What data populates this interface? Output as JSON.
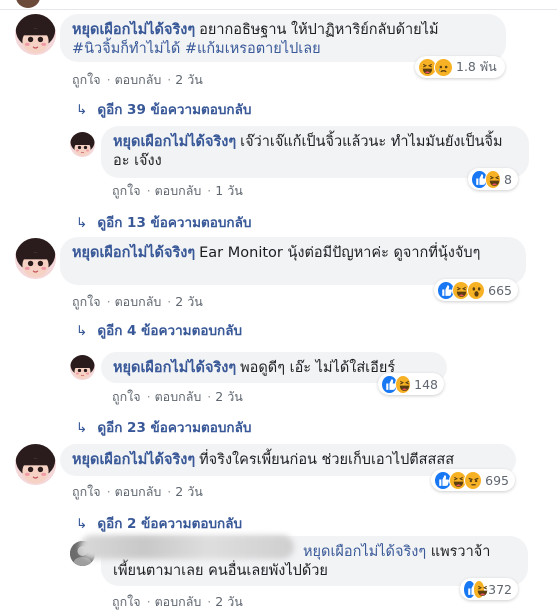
{
  "comments": [
    {
      "author": "หยุดเผือกไม่ได้จริงๆ",
      "text": "อยากอธิษฐาน ให้ปาฏิหาริย์กลับด้ายไม้",
      "tags": "#นิวจิ้มก็ทำไม่ได้ #แก้มเหรอตายไปเลย",
      "like": "ถูกใจ",
      "reply": "ตอบกลับ",
      "time": "2 วัน",
      "reaction_count": "1.8 พัน",
      "reactions": [
        "haha-icon",
        "sad-icon"
      ],
      "more_replies": "ดูอีก 39 ข้อความตอบกลับ"
    },
    {
      "author": "หยุดเผือกไม่ได้จริงๆ",
      "text": "เจ๊ว่าเจ๊แก้เป็นจิ้วแล้วนะ ทำไมมันยังเป็นจิ้มอะ เจ๊งง",
      "like": "ถูกใจ",
      "reply": "ตอบกลับ",
      "time": "1 วัน",
      "reaction_count": "8",
      "reactions": [
        "like-icon",
        "haha-icon"
      ],
      "more_replies": "ดูอีก 13 ข้อความตอบกลับ"
    },
    {
      "author": "หยุดเผือกไม่ได้จริงๆ",
      "text": "Ear Monitor นุ้งต่อมีปัญหาค่ะ ดูจากที่นุ้งจับๆ",
      "like": "ถูกใจ",
      "reply": "ตอบกลับ",
      "time": "2 วัน",
      "reaction_count": "665",
      "reactions": [
        "like-icon",
        "haha-icon",
        "wow-icon"
      ],
      "more_replies": "ดูอีก 4 ข้อความตอบกลับ"
    },
    {
      "author": "หยุดเผือกไม่ได้จริงๆ",
      "text": "พอดูดีๆ เอ๊ะ ไม่ได้ใส่เอียร์",
      "like": "ถูกใจ",
      "reply": "ตอบกลับ",
      "time": "2 วัน",
      "reaction_count": "148",
      "reactions": [
        "like-icon",
        "haha-icon"
      ],
      "more_replies": "ดูอีก 23 ข้อความตอบกลับ"
    },
    {
      "author": "หยุดเผือกไม่ได้จริงๆ",
      "text": "ที่จริงใครเพี้ยนก่อน ช่วยเก็บเอาไปตีสสสส",
      "like": "ถูกใจ",
      "reply": "ตอบกลับ",
      "time": "2 วัน",
      "reaction_count": "695",
      "reactions": [
        "like-icon",
        "haha-icon",
        "angry-icon"
      ],
      "more_replies": "ดูอีก 2 ข้อความตอบกลับ"
    },
    {
      "mention": "หยุดเผือกไม่ได้จริงๆ",
      "text1": "แพรวาจ้า",
      "text2": "เพี้ยนตามาเลย คนอื่นเลยพังไปด้วย",
      "like": "ถูกใจ",
      "reply": "ตอบกลับ",
      "time": "2 วัน",
      "reaction_count": "372",
      "reactions": [
        "like-icon",
        "haha-icon"
      ]
    }
  ],
  "colors": {
    "link": "#385898",
    "bubble": "#f2f3f5",
    "meta": "#606770",
    "like": "#1877f2",
    "emoji": "#f7b125"
  }
}
